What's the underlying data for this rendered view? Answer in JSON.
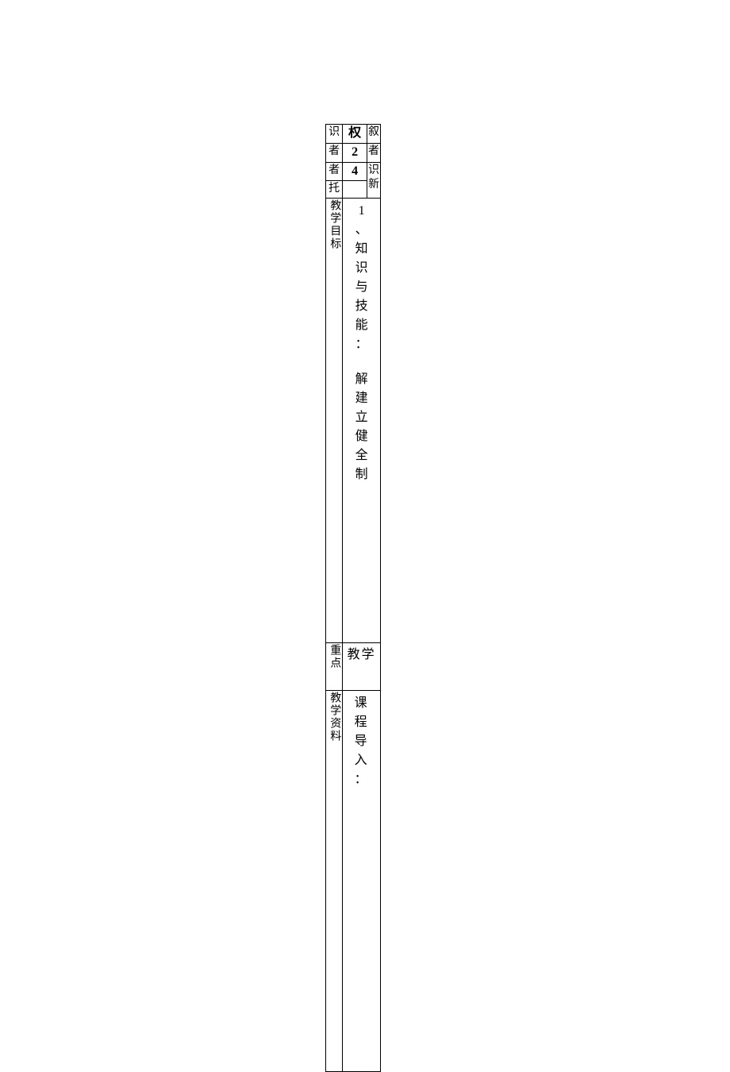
{
  "title": "权",
  "left_col": {
    "r1": "识",
    "r2": "者",
    "r3": "者",
    "r4": "托",
    "r5": "教学目标",
    "r6": "重点",
    "r7": "教学资料"
  },
  "mid_col": {
    "r2": "2",
    "r3": "4",
    "r4": "",
    "goals": {
      "line1": "1",
      "line2": "、",
      "line3": "知",
      "line4": "识",
      "line5": "与",
      "line6": "技",
      "line7": "能",
      "line8": "：",
      "line9_blank": "",
      "line10": "解",
      "line11": "建",
      "line12": "立",
      "line13": "健",
      "line14": "全",
      "line15": "制"
    },
    "focus": "教学",
    "method": "课程导入："
  },
  "right_col": {
    "r1": "叙",
    "r2": "者",
    "r3": "识",
    "r4": "新"
  }
}
